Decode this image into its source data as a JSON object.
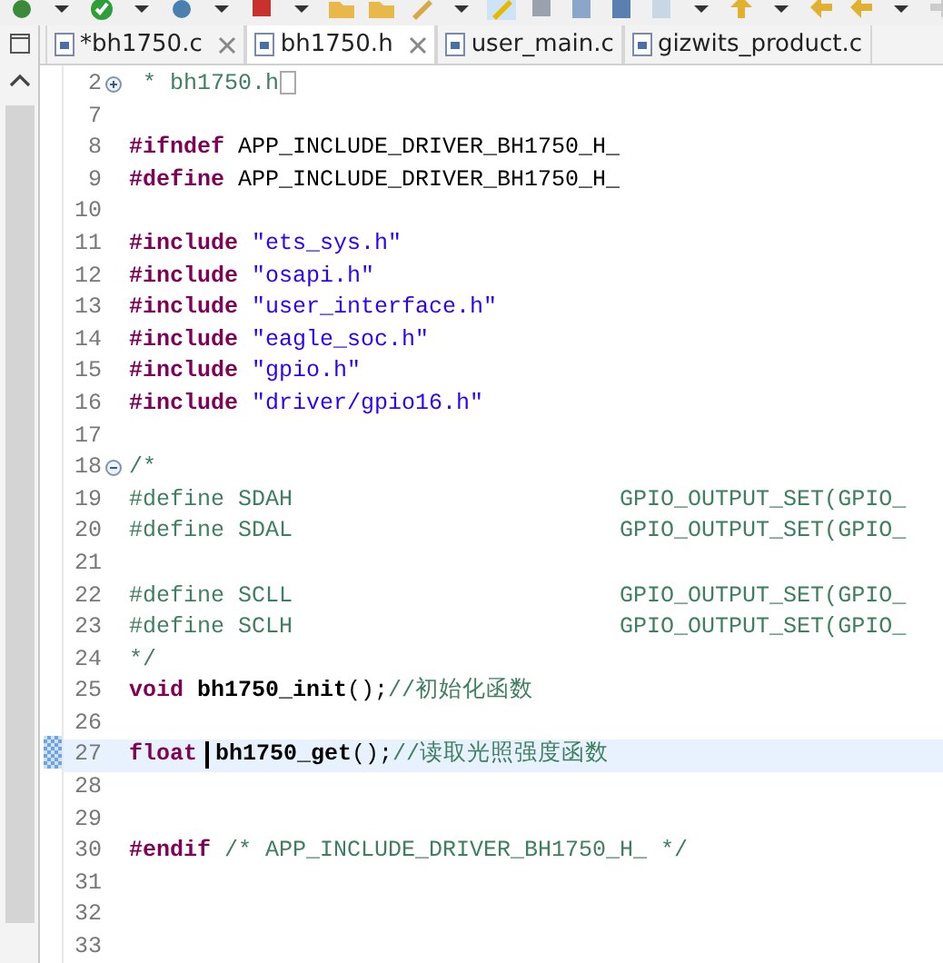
{
  "tabs": [
    {
      "label": "*bh1750.c",
      "selected": false,
      "close_button": true
    },
    {
      "label": "bh1750.h",
      "selected": true,
      "close_button": true
    },
    {
      "label": "user_main.c",
      "selected": false,
      "close_button": false
    },
    {
      "label": "gizwits_product.c",
      "selected": false,
      "close_button": false
    }
  ],
  "editor": {
    "lines": [
      {
        "number": "2",
        "collapsed": true,
        "current": false,
        "folded_box": true,
        "tokens": [
          {
            "kind": "comment",
            "text": " * bh1750.h"
          }
        ]
      },
      {
        "number": "7",
        "current": false
      },
      {
        "number": "8",
        "current": false,
        "tokens": [
          {
            "kind": "keyword",
            "text": "#ifndef"
          },
          {
            "kind": "plain",
            "text": " APP_INCLUDE_DRIVER_BH1750_H_"
          }
        ]
      },
      {
        "number": "9",
        "current": false,
        "tokens": [
          {
            "kind": "keyword",
            "text": "#define"
          },
          {
            "kind": "plain",
            "text": " APP_INCLUDE_DRIVER_BH1750_H_"
          }
        ]
      },
      {
        "number": "10",
        "current": false
      },
      {
        "number": "11",
        "current": false,
        "tokens": [
          {
            "kind": "keyword",
            "text": "#include"
          },
          {
            "kind": "string",
            "text": " \"ets_sys.h\""
          }
        ]
      },
      {
        "number": "12",
        "current": false,
        "tokens": [
          {
            "kind": "keyword",
            "text": "#include"
          },
          {
            "kind": "string",
            "text": " \"osapi.h\""
          }
        ]
      },
      {
        "number": "13",
        "current": false,
        "tokens": [
          {
            "kind": "keyword",
            "text": "#include"
          },
          {
            "kind": "string",
            "text": " \"user_interface.h\""
          }
        ]
      },
      {
        "number": "14",
        "current": false,
        "tokens": [
          {
            "kind": "keyword",
            "text": "#include"
          },
          {
            "kind": "string",
            "text": " \"eagle_soc.h\""
          }
        ]
      },
      {
        "number": "15",
        "current": false,
        "tokens": [
          {
            "kind": "keyword",
            "text": "#include"
          },
          {
            "kind": "string",
            "text": " \"gpio.h\""
          }
        ]
      },
      {
        "number": "16",
        "current": false,
        "tokens": [
          {
            "kind": "keyword",
            "text": "#include"
          },
          {
            "kind": "string",
            "text": " \"driver/gpio16.h\""
          }
        ]
      },
      {
        "number": "17",
        "current": false
      },
      {
        "number": "18",
        "collapsed": false,
        "current": false,
        "tokens": [
          {
            "kind": "comment",
            "text": "/*"
          }
        ]
      },
      {
        "number": "19",
        "current": false,
        "tokens": [
          {
            "kind": "comment",
            "text": "#define SDAH                        GPIO_OUTPUT_SET(GPIO_"
          }
        ]
      },
      {
        "number": "20",
        "current": false,
        "tokens": [
          {
            "kind": "comment",
            "text": "#define SDAL                        GPIO_OUTPUT_SET(GPIO_"
          }
        ]
      },
      {
        "number": "21",
        "current": false
      },
      {
        "number": "22",
        "current": false,
        "tokens": [
          {
            "kind": "comment",
            "text": "#define SCLL                        GPIO_OUTPUT_SET(GPIO_"
          }
        ]
      },
      {
        "number": "23",
        "current": false,
        "tokens": [
          {
            "kind": "comment",
            "text": "#define SCLH                        GPIO_OUTPUT_SET(GPIO_"
          }
        ]
      },
      {
        "number": "24",
        "current": false,
        "tokens": [
          {
            "kind": "comment",
            "text": "*/"
          }
        ]
      },
      {
        "number": "25",
        "current": false,
        "tokens": [
          {
            "kind": "keyword",
            "text": "void"
          },
          {
            "kind": "function",
            "text": " bh1750_init"
          },
          {
            "kind": "plain",
            "text": "();"
          },
          {
            "kind": "comment",
            "text": "//初始化函数"
          }
        ]
      },
      {
        "number": "26",
        "current": false
      },
      {
        "number": "27",
        "current": true,
        "tokens": [
          {
            "kind": "keyword",
            "text": "float"
          },
          {
            "kind": "cursor"
          },
          {
            "kind": "function",
            "text": "bh1750_get"
          },
          {
            "kind": "plain",
            "text": "();"
          },
          {
            "kind": "comment",
            "text": "//读取光照强度函数"
          }
        ]
      },
      {
        "number": "28",
        "current": false
      },
      {
        "number": "29",
        "current": false
      },
      {
        "number": "30",
        "current": false,
        "tokens": [
          {
            "kind": "keyword",
            "text": "#endif"
          },
          {
            "kind": "comment",
            "text": " /* APP_INCLUDE_DRIVER_BH1750_H_ */"
          }
        ]
      },
      {
        "number": "31",
        "current": false
      },
      {
        "number": "32",
        "current": false
      },
      {
        "number": "33",
        "current": false
      }
    ]
  }
}
